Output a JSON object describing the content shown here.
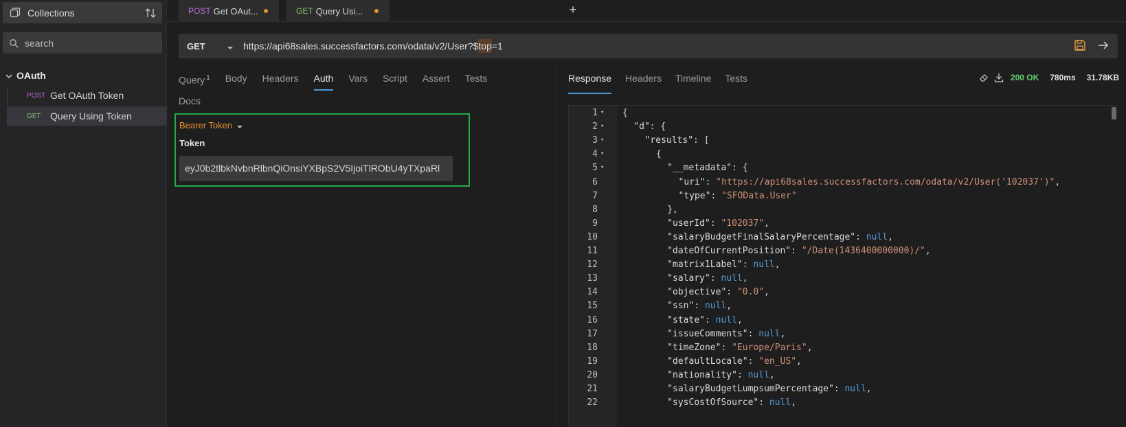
{
  "sidebar": {
    "collections_label": "Collections",
    "search_placeholder": "search",
    "folder_name": "OAuth",
    "items": [
      {
        "method": "POST",
        "name": "Get OAuth Token"
      },
      {
        "method": "GET",
        "name": "Query Using Token"
      }
    ]
  },
  "tabs": [
    {
      "method": "POST",
      "name": "Get OAut..."
    },
    {
      "method": "GET",
      "name": "Query Usi..."
    }
  ],
  "add_tab_label": "+",
  "request": {
    "method": "GET",
    "url_prefix": "https://api68sales.successfactors.com/odata/v2/User?$",
    "url_highlight": "top",
    "url_suffix": "=1",
    "tabs": [
      "Query",
      "Body",
      "Headers",
      "Auth",
      "Vars",
      "Script",
      "Assert",
      "Tests"
    ],
    "query_count": "1",
    "docs_tab": "Docs",
    "auth_mode": "Bearer Token",
    "token_label": "Token",
    "token_value": "eyJ0b2tlbkNvbnRlbnQiOnsiYXBpS2V5IjoiTlRObU4yTXpaRl"
  },
  "response": {
    "tabs": [
      "Response",
      "Headers",
      "Timeline",
      "Tests"
    ],
    "status": "200 OK",
    "time": "780ms",
    "size": "31.78KB",
    "lines": [
      {
        "n": "1",
        "fold": true,
        "indent": 0,
        "parts": [
          [
            "p",
            "{"
          ]
        ]
      },
      {
        "n": "2",
        "fold": true,
        "indent": 1,
        "parts": [
          [
            "k",
            "\"d\""
          ],
          [
            "p",
            ": {"
          ]
        ]
      },
      {
        "n": "3",
        "fold": true,
        "indent": 2,
        "parts": [
          [
            "k",
            "\"results\""
          ],
          [
            "p",
            ": ["
          ]
        ]
      },
      {
        "n": "4",
        "fold": true,
        "indent": 3,
        "parts": [
          [
            "p",
            "{"
          ]
        ]
      },
      {
        "n": "5",
        "fold": true,
        "indent": 4,
        "parts": [
          [
            "k",
            "\"__metadata\""
          ],
          [
            "p",
            ": {"
          ]
        ]
      },
      {
        "n": "6",
        "fold": false,
        "indent": 5,
        "parts": [
          [
            "k",
            "\"uri\""
          ],
          [
            "p",
            ": "
          ],
          [
            "s",
            "\"https://api68sales.successfactors.com/odata/v2/User('102037')\""
          ],
          [
            "p",
            ","
          ]
        ]
      },
      {
        "n": "7",
        "fold": false,
        "indent": 5,
        "parts": [
          [
            "k",
            "\"type\""
          ],
          [
            "p",
            ": "
          ],
          [
            "s",
            "\"SFOData.User\""
          ]
        ]
      },
      {
        "n": "8",
        "fold": false,
        "indent": 4,
        "parts": [
          [
            "p",
            "},"
          ]
        ]
      },
      {
        "n": "9",
        "fold": false,
        "indent": 4,
        "parts": [
          [
            "k",
            "\"userId\""
          ],
          [
            "p",
            ": "
          ],
          [
            "s",
            "\"102037\""
          ],
          [
            "p",
            ","
          ]
        ]
      },
      {
        "n": "10",
        "fold": false,
        "indent": 4,
        "parts": [
          [
            "k",
            "\"salaryBudgetFinalSalaryPercentage\""
          ],
          [
            "p",
            ": "
          ],
          [
            "n",
            "null"
          ],
          [
            "p",
            ","
          ]
        ]
      },
      {
        "n": "11",
        "fold": false,
        "indent": 4,
        "parts": [
          [
            "k",
            "\"dateOfCurrentPosition\""
          ],
          [
            "p",
            ": "
          ],
          [
            "s",
            "\"/Date(1436400000000)/\""
          ],
          [
            "p",
            ","
          ]
        ]
      },
      {
        "n": "12",
        "fold": false,
        "indent": 4,
        "parts": [
          [
            "k",
            "\"matrix1Label\""
          ],
          [
            "p",
            ": "
          ],
          [
            "n",
            "null"
          ],
          [
            "p",
            ","
          ]
        ]
      },
      {
        "n": "13",
        "fold": false,
        "indent": 4,
        "parts": [
          [
            "k",
            "\"salary\""
          ],
          [
            "p",
            ": "
          ],
          [
            "n",
            "null"
          ],
          [
            "p",
            ","
          ]
        ]
      },
      {
        "n": "14",
        "fold": false,
        "indent": 4,
        "parts": [
          [
            "k",
            "\"objective\""
          ],
          [
            "p",
            ": "
          ],
          [
            "s",
            "\"0.0\""
          ],
          [
            "p",
            ","
          ]
        ]
      },
      {
        "n": "15",
        "fold": false,
        "indent": 4,
        "parts": [
          [
            "k",
            "\"ssn\""
          ],
          [
            "p",
            ": "
          ],
          [
            "n",
            "null"
          ],
          [
            "p",
            ","
          ]
        ]
      },
      {
        "n": "16",
        "fold": false,
        "indent": 4,
        "parts": [
          [
            "k",
            "\"state\""
          ],
          [
            "p",
            ": "
          ],
          [
            "n",
            "null"
          ],
          [
            "p",
            ","
          ]
        ]
      },
      {
        "n": "17",
        "fold": false,
        "indent": 4,
        "parts": [
          [
            "k",
            "\"issueComments\""
          ],
          [
            "p",
            ": "
          ],
          [
            "n",
            "null"
          ],
          [
            "p",
            ","
          ]
        ]
      },
      {
        "n": "18",
        "fold": false,
        "indent": 4,
        "parts": [
          [
            "k",
            "\"timeZone\""
          ],
          [
            "p",
            ": "
          ],
          [
            "s",
            "\"Europe/Paris\""
          ],
          [
            "p",
            ","
          ]
        ]
      },
      {
        "n": "19",
        "fold": false,
        "indent": 4,
        "parts": [
          [
            "k",
            "\"defaultLocale\""
          ],
          [
            "p",
            ": "
          ],
          [
            "s",
            "\"en_US\""
          ],
          [
            "p",
            ","
          ]
        ]
      },
      {
        "n": "20",
        "fold": false,
        "indent": 4,
        "parts": [
          [
            "k",
            "\"nationality\""
          ],
          [
            "p",
            ": "
          ],
          [
            "n",
            "null"
          ],
          [
            "p",
            ","
          ]
        ]
      },
      {
        "n": "21",
        "fold": false,
        "indent": 4,
        "parts": [
          [
            "k",
            "\"salaryBudgetLumpsumPercentage\""
          ],
          [
            "p",
            ": "
          ],
          [
            "n",
            "null"
          ],
          [
            "p",
            ","
          ]
        ]
      },
      {
        "n": "22",
        "fold": false,
        "indent": 4,
        "parts": [
          [
            "k",
            "\"sysCostOfSource\""
          ],
          [
            "p",
            ": "
          ],
          [
            "n",
            "null"
          ],
          [
            "p",
            ","
          ]
        ]
      }
    ]
  },
  "colors": {
    "accent_blue": "#4a9bdc",
    "auth_border": "#22aa44",
    "bearer": "#e8912d",
    "status_ok": "#5fd16a",
    "method_post": "#c06bd9",
    "method_get": "#7ec36c"
  }
}
